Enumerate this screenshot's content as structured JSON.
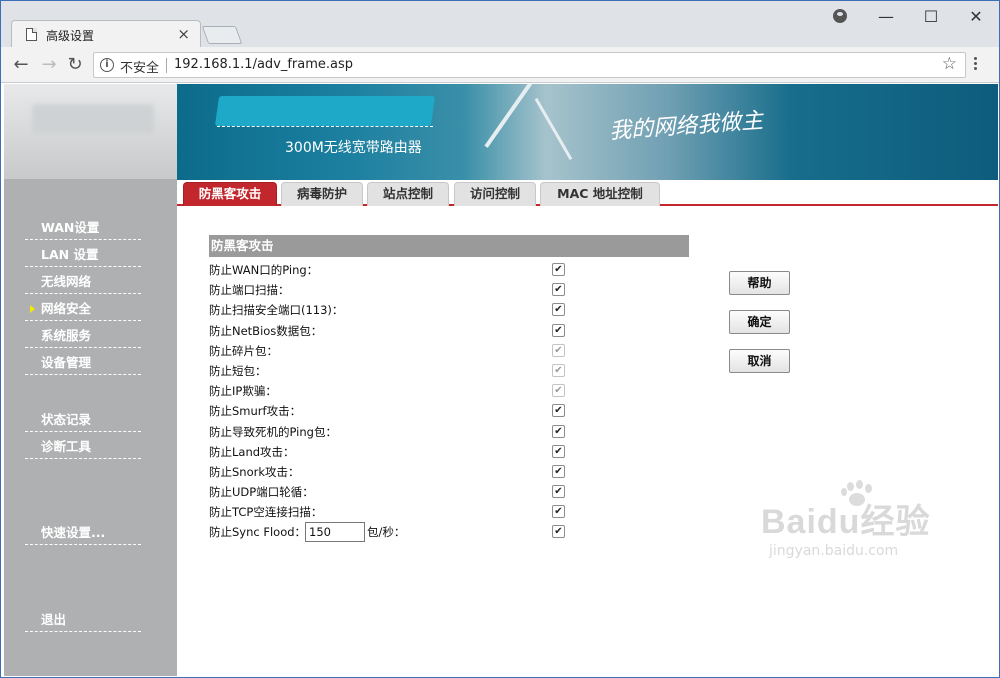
{
  "browser": {
    "tab_title": "高级设置",
    "tab_close": "×",
    "secure_label": "不安全",
    "url": "192.168.1.1/adv_frame.asp",
    "minimize": "—",
    "maximize": "☐",
    "close": "✕",
    "back": "←",
    "forward": "→",
    "reload": "↻",
    "info": "i",
    "star": "☆"
  },
  "banner": {
    "subtitle": "300M无线宽带路由器",
    "slogan": "我的网络我做主"
  },
  "sidebar": {
    "items": [
      {
        "label": "WAN设置",
        "active": false
      },
      {
        "label": "LAN 设置",
        "active": false
      },
      {
        "label": "无线网络",
        "active": false
      },
      {
        "label": "网络安全",
        "active": true
      },
      {
        "label": "系统服务",
        "active": false
      },
      {
        "label": "设备管理",
        "active": false
      },
      {
        "label": "状态记录",
        "active": false
      },
      {
        "label": "诊断工具",
        "active": false
      },
      {
        "label": "快速设置...",
        "active": false
      },
      {
        "label": "退出",
        "active": false
      }
    ]
  },
  "tabs": [
    {
      "label": "防黑客攻击",
      "active": true
    },
    {
      "label": "病毒防护",
      "active": false
    },
    {
      "label": "站点控制",
      "active": false
    },
    {
      "label": "访问控制",
      "active": false
    },
    {
      "label": "MAC 地址控制",
      "active": false
    }
  ],
  "panel": {
    "header": "防黑客攻击",
    "options": [
      {
        "label": "防止WAN口的Ping：",
        "checked": true,
        "enabled": true
      },
      {
        "label": "防止端口扫描：",
        "checked": true,
        "enabled": true
      },
      {
        "label": "防止扫描安全端口(113)：",
        "checked": true,
        "enabled": true
      },
      {
        "label": "防止NetBios数据包：",
        "checked": true,
        "enabled": true
      },
      {
        "label": "防止碎片包：",
        "checked": true,
        "enabled": false
      },
      {
        "label": "防止短包：",
        "checked": true,
        "enabled": false
      },
      {
        "label": "防止IP欺骗：",
        "checked": true,
        "enabled": false
      },
      {
        "label": "防止Smurf攻击：",
        "checked": true,
        "enabled": true
      },
      {
        "label": "防止导致死机的Ping包：",
        "checked": true,
        "enabled": true
      },
      {
        "label": "防止Land攻击：",
        "checked": true,
        "enabled": true
      },
      {
        "label": "防止Snork攻击：",
        "checked": true,
        "enabled": true
      },
      {
        "label": "防止UDP端口轮循：",
        "checked": true,
        "enabled": true
      },
      {
        "label": "防止TCP空连接扫描：",
        "checked": true,
        "enabled": true
      }
    ],
    "sync_flood": {
      "label": "防止Sync Flood：",
      "value": "150",
      "unit": "包/秒：",
      "checked": true
    }
  },
  "actions": {
    "help": "帮助",
    "ok": "确定",
    "cancel": "取消"
  },
  "watermark": {
    "main": "Baidu经验",
    "sub": "jingyan.baidu.com"
  },
  "check_glyph": "✔",
  "colors": {
    "accent_red": "#c1272d",
    "sidebar_gray": "#aeb0b2",
    "banner_teal": "#1b7fa0",
    "panel_header_gray": "#9a9a9a"
  }
}
